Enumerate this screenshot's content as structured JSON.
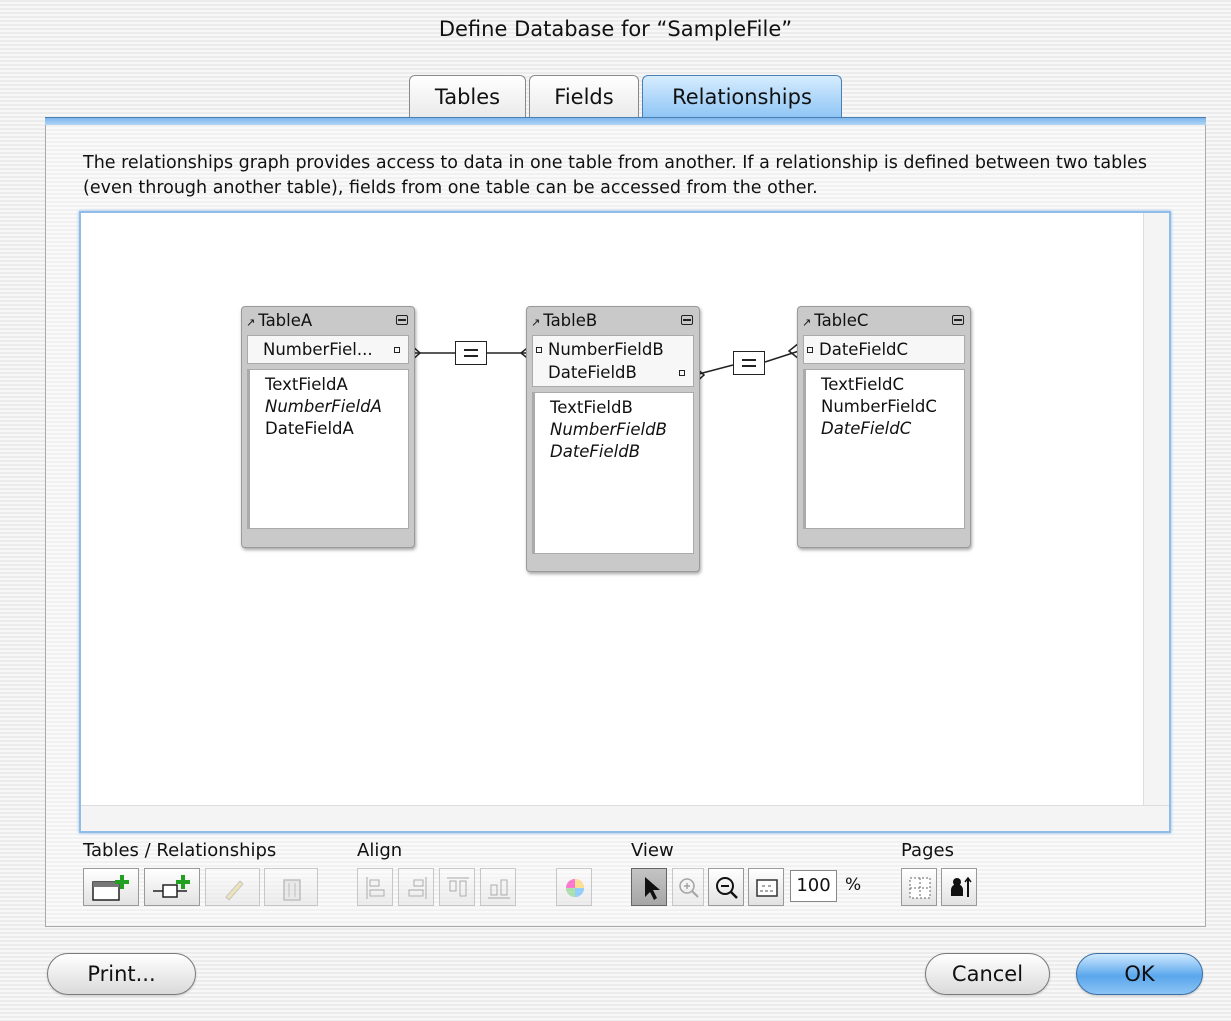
{
  "window": {
    "title": "Define Database for “SampleFile”"
  },
  "tabs": [
    {
      "label": "Tables",
      "active": false
    },
    {
      "label": "Fields",
      "active": false
    },
    {
      "label": "Relationships",
      "active": true
    }
  ],
  "description": "The relationships graph provides access to data in one table from another. If a relationship is defined between two tables (even through another table), fields from one table can be accessed from the other.",
  "graph": {
    "tables": [
      {
        "name": "TableA",
        "keys": [
          "NumberFiel..."
        ],
        "fields": [
          {
            "label": "TextFieldA",
            "italic": false
          },
          {
            "label": "NumberFieldA",
            "italic": true
          },
          {
            "label": "DateFieldA",
            "italic": false
          }
        ]
      },
      {
        "name": "TableB",
        "keys": [
          "NumberFieldB",
          "DateFieldB"
        ],
        "fields": [
          {
            "label": "TextFieldB",
            "italic": false
          },
          {
            "label": "NumberFieldB",
            "italic": true
          },
          {
            "label": "DateFieldB",
            "italic": true
          }
        ]
      },
      {
        "name": "TableC",
        "keys": [
          "DateFieldC"
        ],
        "fields": [
          {
            "label": "TextFieldC",
            "italic": false
          },
          {
            "label": "NumberFieldC",
            "italic": false
          },
          {
            "label": "DateFieldC",
            "italic": true
          }
        ]
      }
    ],
    "relationships": [
      {
        "from": "TableA::NumberFiel...",
        "to": "TableB::NumberFieldB",
        "operator": "="
      },
      {
        "from": "TableB::DateFieldB",
        "to": "TableC::DateFieldC",
        "operator": "="
      }
    ]
  },
  "toolbar": {
    "groups": {
      "tables_relationships": "Tables / Relationships",
      "align": "Align",
      "view": "View",
      "pages": "Pages"
    },
    "zoom_value": "100",
    "zoom_unit": "%",
    "icons": [
      "add-table-icon",
      "add-relationship-icon",
      "edit-icon",
      "delete-icon",
      "align-left-icon",
      "align-right-icon",
      "align-top-icon",
      "align-bottom-icon",
      "color-icon",
      "pointer-icon",
      "zoom-in-icon",
      "zoom-out-icon",
      "fit-window-icon",
      "page-breaks-icon",
      "page-setup-icon"
    ]
  },
  "buttons": {
    "print": "Print...",
    "cancel": "Cancel",
    "ok": "OK"
  },
  "colors": {
    "accent": "#8cc4f4",
    "accent_dark": "#4a7fb5",
    "add_green": "#22a022"
  }
}
